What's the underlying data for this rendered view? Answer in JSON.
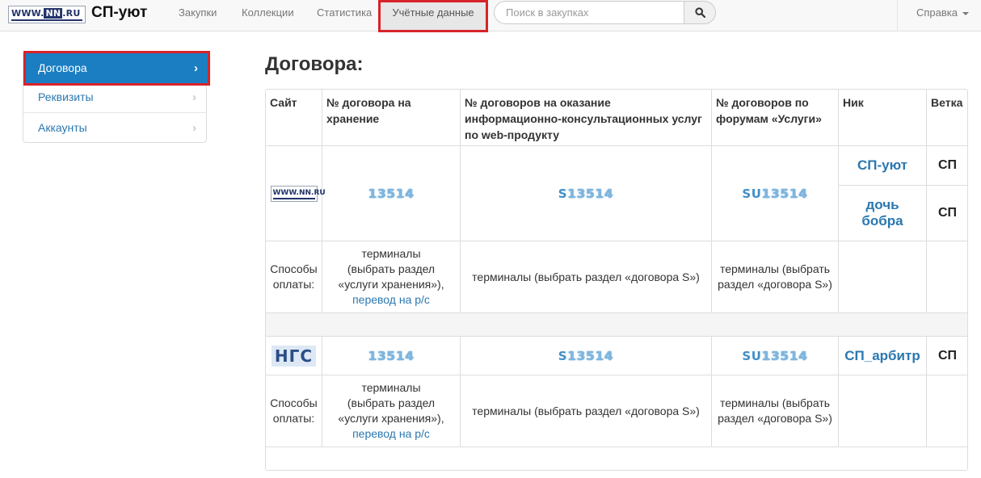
{
  "navbar": {
    "logo_text": "WWW.NN.RU",
    "brand": "СП-уют",
    "links": [
      "Закупки",
      "Коллекции",
      "Статистика",
      "Учётные данные"
    ],
    "search_placeholder": "Поиск в закупках",
    "help": "Справка"
  },
  "sidebar": {
    "items": [
      {
        "label": "Договора",
        "active": true
      },
      {
        "label": "Реквизиты",
        "active": false
      },
      {
        "label": "Аккаунты",
        "active": false
      }
    ]
  },
  "main": {
    "title": "Договора:",
    "headers": [
      "Сайт",
      "№ договора на хранение",
      "№ договоров на оказание информационно-консультационных услуг по web-продукту",
      "№ договоров по форумам «Услуги»",
      "Ник",
      "Ветка"
    ],
    "blocks": [
      {
        "site_logo": "WWW.NN.RU",
        "storage_contract": "13514",
        "web_prefix": "S",
        "web_number": "13514",
        "forum_prefix": "SU",
        "forum_number": "13514",
        "accounts": [
          {
            "nick": "СП-уют",
            "branch": "СП"
          },
          {
            "nick": "дочь бобра",
            "branch": "СП"
          }
        ],
        "payment": {
          "label": "Способы оплаты:",
          "storage": "терминалы (выбрать раздел «услуги хранения»),",
          "storage_link": "перевод на р/с",
          "web": "терминалы (выбрать раздел «договора S»)",
          "forum": "терминалы (выбрать раздел «договора S»)"
        }
      },
      {
        "site_logo": "НГС",
        "storage_contract": "13514",
        "web_prefix": "S",
        "web_number": "13514",
        "forum_prefix": "SU",
        "forum_number": "13514",
        "accounts": [
          {
            "nick": "СП_арбитр",
            "branch": "СП"
          }
        ],
        "payment": {
          "label": "Способы оплаты:",
          "storage": "терминалы (выбрать раздел «услуги хранения»),",
          "storage_link": "перевод на р/с",
          "web": "терминалы (выбрать раздел «договора S»)",
          "forum": "терминалы (выбрать раздел «договора S»)"
        }
      }
    ]
  },
  "colors": {
    "accent": "#1b7ec2",
    "link": "#2a78b0",
    "highlight_border": "#d8232a"
  }
}
